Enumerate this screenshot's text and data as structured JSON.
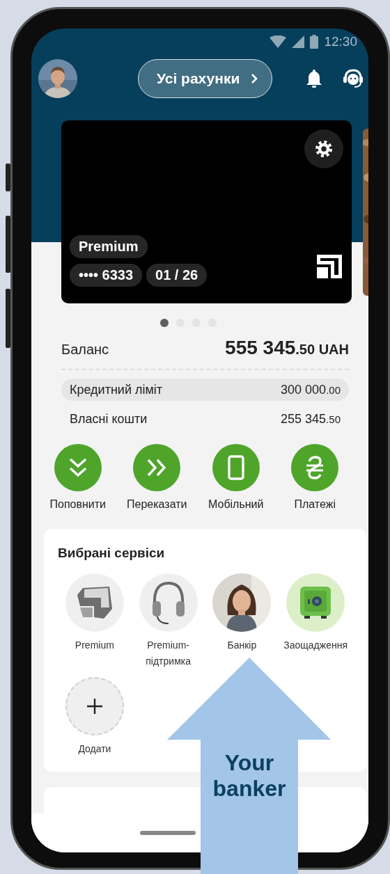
{
  "status_bar": {
    "time": "12:30"
  },
  "header": {
    "accounts_button": "Усі рахунки"
  },
  "card": {
    "name": "Premium",
    "number": "•••• 6333",
    "expiry": "01 / 26"
  },
  "pager": [
    {
      "selected": true
    },
    {
      "selected": false
    },
    {
      "selected": false
    },
    {
      "selected": false
    }
  ],
  "balance": {
    "label": "Баланс",
    "whole": "555 345",
    "fraction": ".50 UAH"
  },
  "details": [
    {
      "label": "Кредитний ліміт",
      "whole": "300 000",
      "fraction": ".00",
      "highlighted": true
    },
    {
      "label": "Власні кошти",
      "whole": "255 345",
      "fraction": ".50",
      "highlighted": false
    }
  ],
  "actions": [
    {
      "kind": "top-up",
      "label": "Поповнити"
    },
    {
      "kind": "transfer",
      "label": "Переказати"
    },
    {
      "kind": "mobile",
      "label": "Мобільний"
    },
    {
      "kind": "payments",
      "label": "Платежі"
    }
  ],
  "services": {
    "title": "Вибрані сервіси",
    "items": [
      {
        "kind": "premium",
        "label": "Premium"
      },
      {
        "kind": "support",
        "label": "Premium-підтримка"
      },
      {
        "kind": "picture",
        "label": "Банкір"
      },
      {
        "kind": "savings",
        "label": "Заощадження"
      },
      {
        "kind": "add",
        "label": "Додати"
      }
    ]
  },
  "callout": {
    "text": "Your banker"
  }
}
